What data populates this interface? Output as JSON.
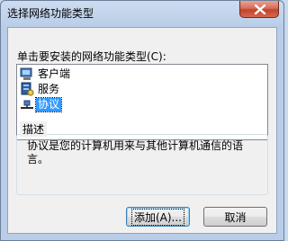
{
  "window": {
    "title": "选择网络功能类型"
  },
  "prompt": "单击要安装的网络功能类型(C):",
  "feature_list": {
    "items": [
      {
        "label": "客户端",
        "icon": "client-computer-icon",
        "selected": false
      },
      {
        "label": "服务",
        "icon": "service-icon",
        "selected": false
      },
      {
        "label": "协议",
        "icon": "protocol-icon",
        "selected": true
      }
    ]
  },
  "description": {
    "title": "描述",
    "text": "协议是您的计算机用来与其他计算机通信的语言。"
  },
  "buttons": {
    "add": "添加(A)...",
    "cancel": "取消"
  },
  "colors": {
    "selection": "#3399ff",
    "close_button": "#c2432c"
  }
}
